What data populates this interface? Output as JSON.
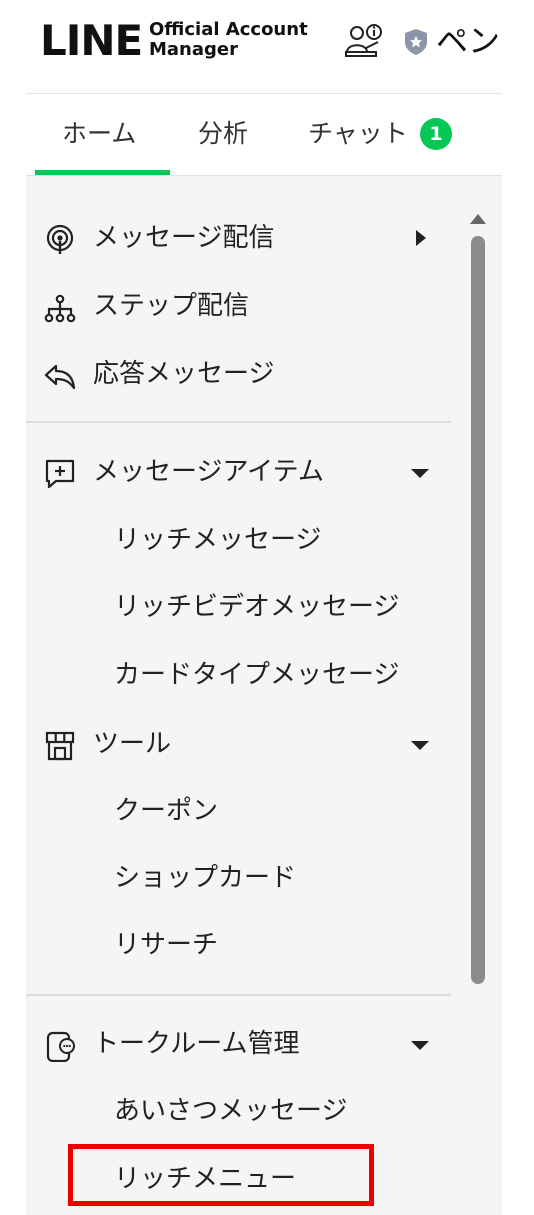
{
  "header": {
    "logo_main": "LINE",
    "logo_sub_1": "Official Account",
    "logo_sub_2": "Manager",
    "account_name": "ペン",
    "icons": [
      "person-info-icon",
      "shield-star-icon"
    ]
  },
  "tabs": [
    {
      "label": "ホーム",
      "active": true
    },
    {
      "label": "分析",
      "active": false
    },
    {
      "label": "チャット",
      "active": false,
      "badge": "1"
    }
  ],
  "menu": {
    "messaging": {
      "broadcast": "メッセージ配信",
      "step": "ステップ配信",
      "auto_reply": "応答メッセージ"
    },
    "message_items": {
      "label": "メッセージアイテム",
      "children": [
        "リッチメッセージ",
        "リッチビデオメッセージ",
        "カードタイプメッセージ"
      ]
    },
    "tools": {
      "label": "ツール",
      "children": [
        "クーポン",
        "ショップカード",
        "リサーチ"
      ]
    },
    "talk_room": {
      "label": "トークルーム管理",
      "children": [
        "あいさつメッセージ",
        "リッチメニュー"
      ]
    }
  },
  "colors": {
    "accent": "#06c755",
    "highlight": "#ee0000",
    "panel_bg": "#f5f5f5"
  }
}
